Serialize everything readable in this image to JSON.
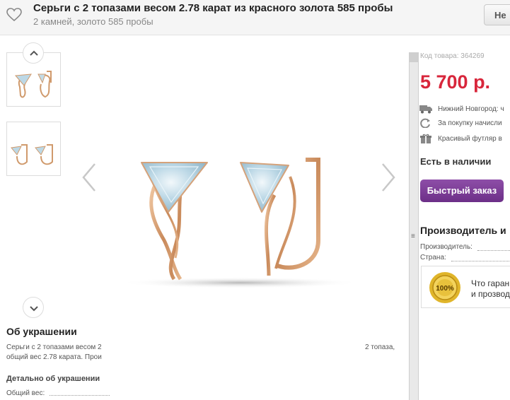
{
  "header": {
    "title": "Серьги с 2 топазами весом 2.78 карат из красного золота 585 пробы",
    "subtitle": "2 камней, золото 585 пробы",
    "button_label": "Не"
  },
  "about": {
    "heading": "Об украшении",
    "text_left_1": "Серьги с 2 топазами весом 2",
    "text_left_2": "общий вес 2.78 карата. Прои",
    "text_right_1": "2 топаза,",
    "text_right_2": "",
    "detail_heading": "Детально об украшении",
    "weight_label": "Общий вес:"
  },
  "product": {
    "code": "Код товара: 364269",
    "price": "5 700 р.",
    "delivery": "Нижний Новгород: ч",
    "bonus": "За покупку начисли",
    "gift": "Красивый футляр в",
    "stock": "Есть в наличии",
    "quick_order": "Быстрый заказ"
  },
  "maker": {
    "heading": "Производитель и",
    "manufacturer_label": "Производитель:",
    "country_label": "Страна:"
  },
  "guarantee": {
    "line1": "Что гаран",
    "line2": "и прозвод"
  },
  "icons": {
    "favorite": "heart-icon",
    "delivery": "truck-icon",
    "bonus": "refresh-icon",
    "gift": "gift-icon",
    "seal": "guarantee-seal-icon"
  },
  "colors": {
    "price": "#d8263b",
    "quick_order": "#7a3895",
    "gold": "#d89a6a",
    "topaz": "#bcd8e6"
  }
}
